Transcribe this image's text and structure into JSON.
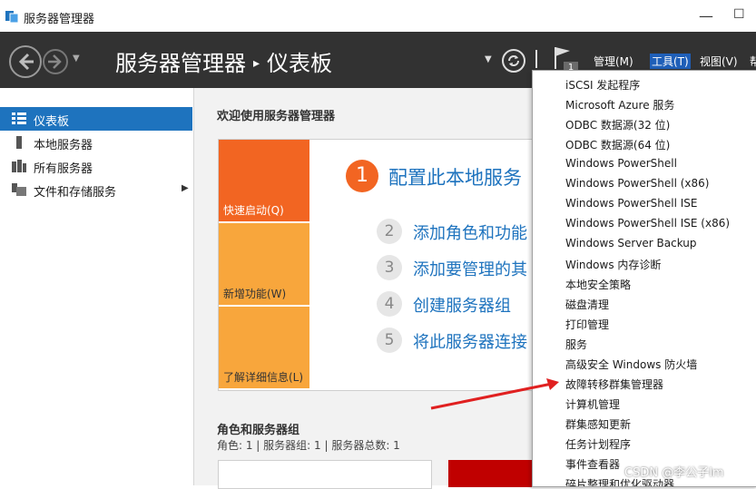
{
  "window": {
    "title": "服务器管理器"
  },
  "header": {
    "breadcrumb": {
      "root": "服务器管理器",
      "separator": "▸",
      "current": "仪表板"
    },
    "notification_count": "1",
    "menus": [
      {
        "label": "管理(M)"
      },
      {
        "label": "工具(T)"
      },
      {
        "label": "视图(V)"
      },
      {
        "label": "帮"
      }
    ]
  },
  "sidebar": {
    "items": [
      {
        "label": "仪表板",
        "icon": "dashboard-icon",
        "active": true
      },
      {
        "label": "本地服务器",
        "icon": "server-icon"
      },
      {
        "label": "所有服务器",
        "icon": "servers-icon"
      },
      {
        "label": "文件和存储服务",
        "icon": "storage-icon",
        "has_submenu": true
      }
    ]
  },
  "main": {
    "welcome": "欢迎使用服务器管理器",
    "tiles": [
      {
        "label": "快速启动(Q)"
      },
      {
        "label": "新增功能(W)"
      },
      {
        "label": "了解详细信息(L)"
      }
    ],
    "steps": [
      {
        "num": "1",
        "text": "配置此本地服务"
      },
      {
        "num": "2",
        "text": "添加角色和功能"
      },
      {
        "num": "3",
        "text": "添加要管理的其"
      },
      {
        "num": "4",
        "text": "创建服务器组"
      },
      {
        "num": "5",
        "text": "将此服务器连接"
      }
    ],
    "roles_title": "角色和服务器组",
    "roles_summary": "角色: 1 | 服务器组: 1 | 服务器总数: 1"
  },
  "tools_menu": {
    "items": [
      "iSCSI 发起程序",
      "Microsoft Azure 服务",
      "ODBC 数据源(32 位)",
      "ODBC 数据源(64 位)",
      "Windows PowerShell",
      "Windows PowerShell (x86)",
      "Windows PowerShell ISE",
      "Windows PowerShell ISE (x86)",
      "Windows Server Backup",
      "Windows 内存诊断",
      "本地安全策略",
      "磁盘清理",
      "打印管理",
      "服务",
      "高级安全 Windows 防火墙",
      "故障转移群集管理器",
      "计算机管理",
      "群集感知更新",
      "任务计划程序",
      "事件查看器",
      "碎片整理和优化驱动器"
    ]
  },
  "watermark": "CSDN @李公子lm",
  "colors": {
    "header_bg": "#323232",
    "accent_blue": "#1e73be",
    "tile_orange": "#f26522",
    "tile_amber": "#f8a63c",
    "annotation_red": "#e02020"
  }
}
